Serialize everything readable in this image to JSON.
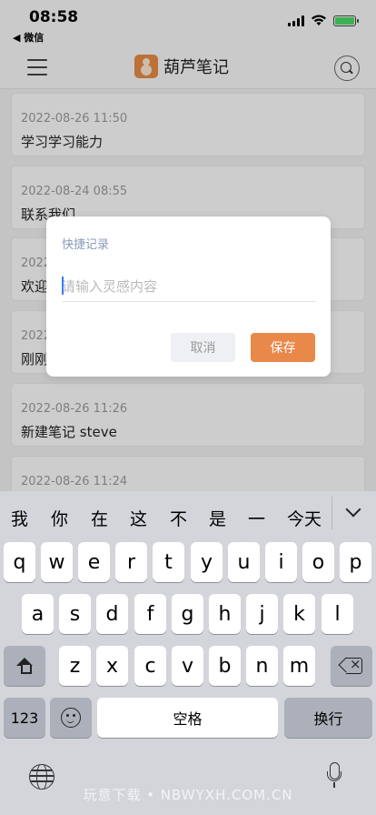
{
  "status_bar": {
    "time": "08:58",
    "back_label": "◀ 微信",
    "battery_level": 1.0
  },
  "header": {
    "title": "葫芦笔记",
    "menu_icon": "hamburger-menu-icon",
    "search_icon": "search-icon"
  },
  "notes": [
    {
      "date": "2022-08-26 11:50",
      "title": "学习学习能力"
    },
    {
      "date": "2022-08-24 08:55",
      "title": "联系我们"
    },
    {
      "date": "2022",
      "title": "欢迎"
    },
    {
      "date": "2022",
      "title": "刚刚"
    },
    {
      "date": "2022-08-26 11:26",
      "title": "新建笔记 steve"
    },
    {
      "date": "2022-08-26 11:24",
      "title": ""
    }
  ],
  "dialog": {
    "title": "快捷记录",
    "input_placeholder": "请输入灵感内容",
    "input_value": "",
    "cancel_label": "取消",
    "save_label": "保存"
  },
  "keyboard": {
    "candidates": [
      "我",
      "你",
      "在",
      "这",
      "不",
      "是",
      "一",
      "今天"
    ],
    "row1": [
      "q",
      "w",
      "e",
      "r",
      "t",
      "y",
      "u",
      "i",
      "o",
      "p"
    ],
    "row2": [
      "a",
      "s",
      "d",
      "f",
      "g",
      "h",
      "j",
      "k",
      "l"
    ],
    "row3": [
      "z",
      "x",
      "c",
      "v",
      "b",
      "n",
      "m"
    ],
    "numbers_label": "123",
    "space_label": "空格",
    "return_label": "换行"
  },
  "watermark": "玩意下载 • NBWYXH.COM.CN",
  "colors": {
    "accent": "#e8894a",
    "dialog_title": "#8a9ab8",
    "keyboard_bg": "#d3d5da"
  }
}
